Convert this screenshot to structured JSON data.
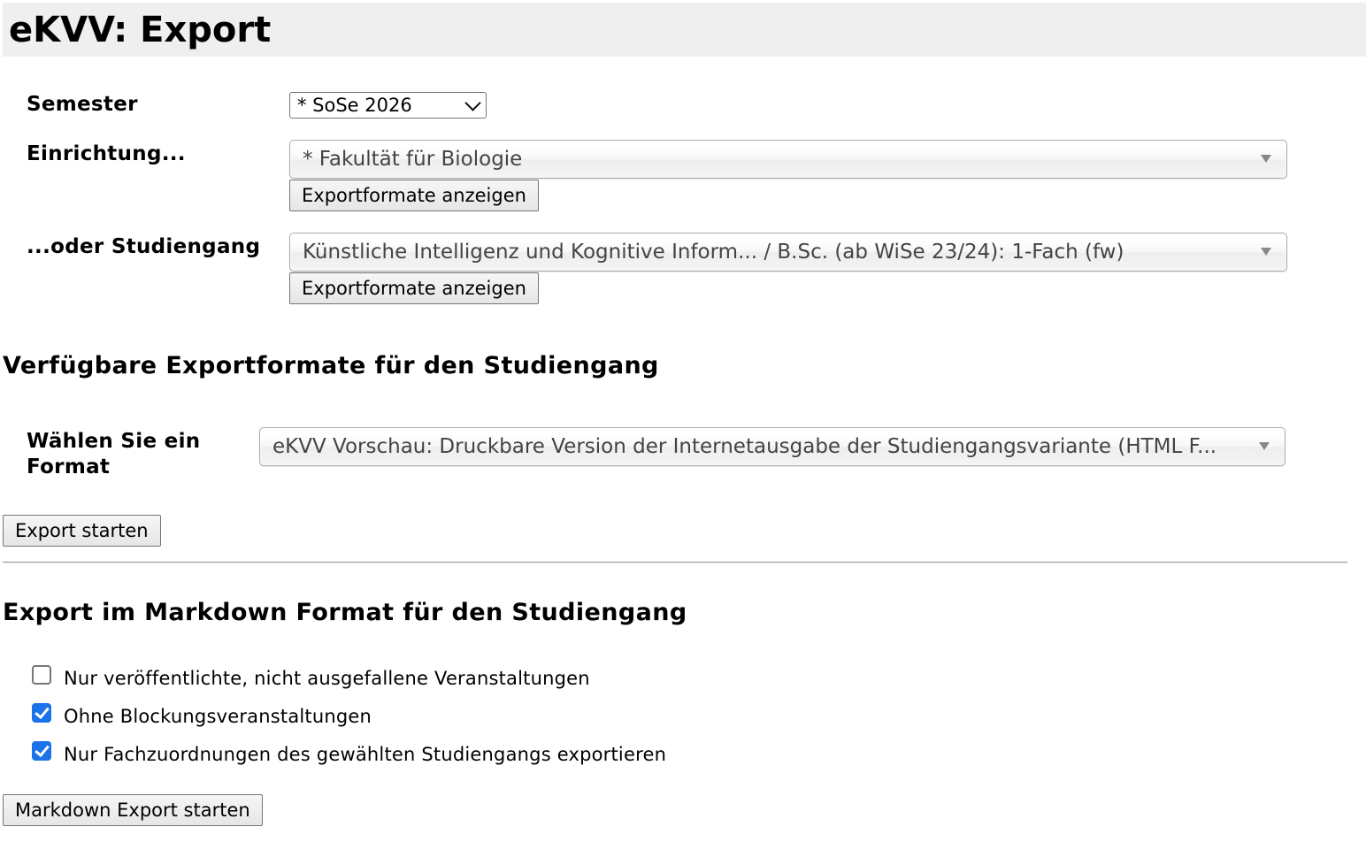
{
  "header": {
    "title": "eKVV: Export"
  },
  "form": {
    "semester_label": "Semester",
    "semester_value": "* SoSe 2026",
    "einrichtung_label": "Einrichtung...",
    "einrichtung_value": "* Fakultät für Biologie",
    "einrichtung_button": "Exportformate anzeigen",
    "studiengang_label": "...oder Studiengang",
    "studiengang_value": "Künstliche Intelligenz und Kognitive Inform... / B.Sc. (ab WiSe 23/24): 1-Fach (fw)",
    "studiengang_button": "Exportformate anzeigen"
  },
  "formats": {
    "heading": "Verfügbare Exportformate für den Studiengang",
    "format_label_line1": "Wählen Sie ein",
    "format_label_line2": "Format",
    "format_value": "eKVV Vorschau: Druckbare Version der Internetausgabe der Studiengangsvariante (HTML F...",
    "start_button": "Export starten"
  },
  "markdown": {
    "heading": "Export im Markdown Format für den Studiengang",
    "options": [
      {
        "label": "Nur veröffentlichte, nicht ausgefallene Veranstaltungen",
        "checked": false
      },
      {
        "label": "Ohne Blockungsveranstaltungen",
        "checked": true
      },
      {
        "label": "Nur Fachzuordnungen des gewählten Studiengangs exportieren",
        "checked": true
      }
    ],
    "start_button": "Markdown Export starten"
  },
  "colors": {
    "header_background": "#efefef",
    "checkbox_checked": "#1a73e8"
  }
}
